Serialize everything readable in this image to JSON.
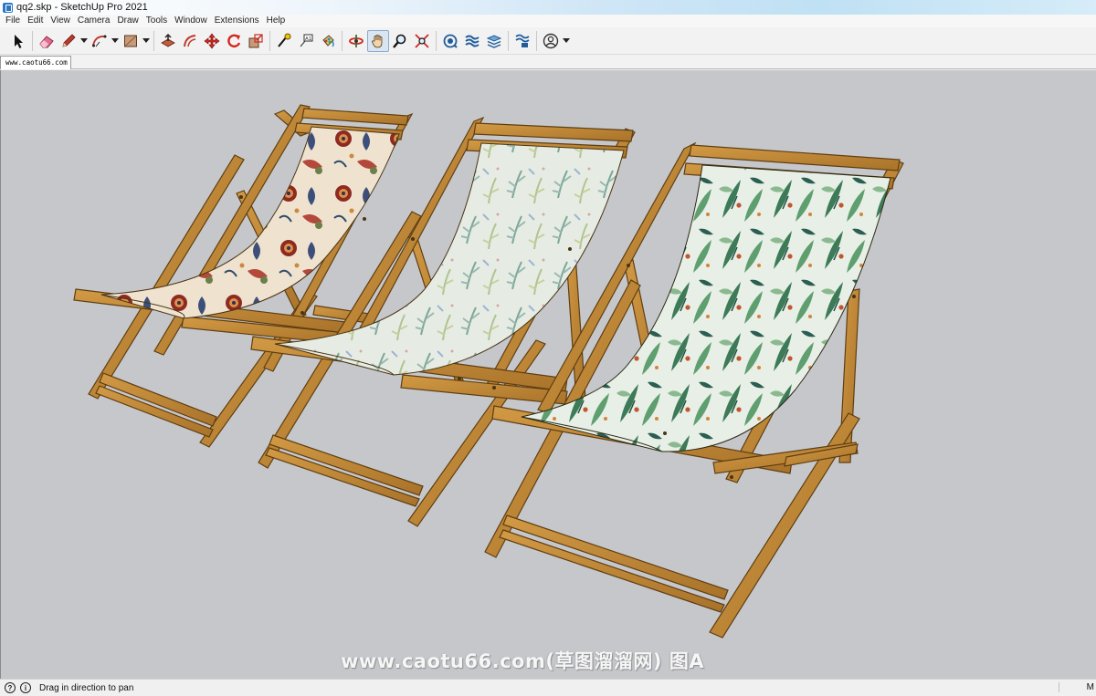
{
  "window": {
    "title": "qq2.skp - SketchUp Pro 2021"
  },
  "menu": {
    "items": [
      "File",
      "Edit",
      "View",
      "Camera",
      "Draw",
      "Tools",
      "Window",
      "Extensions",
      "Help"
    ]
  },
  "toolbar": {
    "tools": [
      {
        "name": "select-tool",
        "icon": "arrow-cursor-icon"
      },
      {
        "name": "eraser-tool",
        "icon": "eraser-icon"
      },
      {
        "name": "line-tool",
        "icon": "pencil-icon"
      },
      {
        "name": "arc-tool",
        "icon": "arc-icon"
      },
      {
        "name": "shape-tool",
        "icon": "rectangle-icon"
      },
      {
        "name": "push-pull-tool",
        "icon": "push-pull-icon"
      },
      {
        "name": "offset-tool",
        "icon": "offset-icon"
      },
      {
        "name": "move-tool",
        "icon": "move-icon"
      },
      {
        "name": "rotate-tool",
        "icon": "rotate-icon"
      },
      {
        "name": "scale-tool",
        "icon": "scale-icon"
      },
      {
        "name": "tape-measure-tool",
        "icon": "tape-measure-icon"
      },
      {
        "name": "text-tool",
        "icon": "text-icon"
      },
      {
        "name": "paint-bucket-tool",
        "icon": "paint-bucket-icon"
      },
      {
        "name": "orbit-tool",
        "icon": "orbit-icon"
      },
      {
        "name": "pan-tool",
        "icon": "hand-icon"
      },
      {
        "name": "zoom-tool",
        "icon": "magnifier-icon"
      },
      {
        "name": "zoom-extents-tool",
        "icon": "zoom-extents-icon"
      },
      {
        "name": "3d-warehouse",
        "icon": "warehouse-icon"
      },
      {
        "name": "extension-warehouse",
        "icon": "extension-icon"
      },
      {
        "name": "layout",
        "icon": "layers-icon"
      },
      {
        "name": "extension-manager",
        "icon": "extension-manager-icon"
      },
      {
        "name": "account",
        "icon": "user-icon"
      }
    ],
    "active_tool": "pan-tool"
  },
  "scene_tab": {
    "label": "www.caotu66.com"
  },
  "viewport": {
    "background": "#c6c7cb",
    "watermark": "www.caotu66.com(草图溜溜网) 图A"
  },
  "status": {
    "message": "Drag in direction to pan",
    "measurements_label": "M"
  },
  "colors": {
    "wood": "#c08a36",
    "wood_dark": "#7a5418",
    "fabric_floral": "#e9d9c8",
    "fabric_pale": "#dde6de",
    "fabric_leaves": "#6f9f7a"
  }
}
